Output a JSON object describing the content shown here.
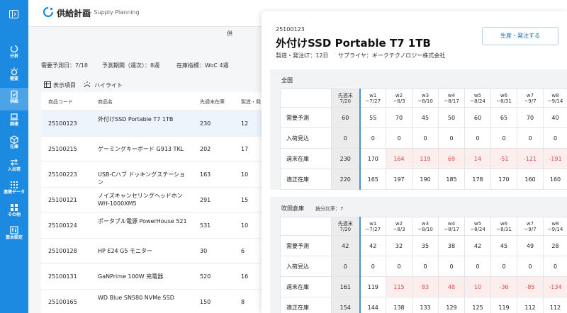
{
  "app": {
    "title": "供給計画",
    "subtitle": "- Supply Planning"
  },
  "sidebar": {
    "items": [
      {
        "label": "分析",
        "icon": "chart-circle-icon"
      },
      {
        "label": "需要",
        "icon": "demand-icon"
      },
      {
        "label": "供給",
        "icon": "clipboard-check-icon"
      },
      {
        "label": "調達",
        "icon": "laptop-icon"
      },
      {
        "label": "在庫",
        "icon": "box-icon"
      },
      {
        "label": "入出荷",
        "icon": "swap-arrows-icon"
      },
      {
        "label": "連携データ",
        "icon": "grid-icon"
      },
      {
        "label": "その他",
        "icon": "apps-icon"
      },
      {
        "label": "基本設定",
        "icon": "sliders-icon"
      }
    ],
    "active_index": 2
  },
  "header": {
    "right_label": "供"
  },
  "filters": {
    "demand_date": "需要予測日：7/18",
    "forecast_period": "予測期間（週次）：8週",
    "stock_index": "在庫指標：WoC 4週"
  },
  "toolbar": {
    "display_items": "表示項目",
    "highlight": "ハイライト"
  },
  "product_list": {
    "columns": [
      "商品コード",
      "商品名",
      "先週末在庫",
      "製造・発"
    ],
    "rows": [
      {
        "code": "25100123",
        "name": "外付けSSD Portable T7 1TB",
        "stock": "230",
        "lt": "12"
      },
      {
        "code": "25100215",
        "name": "ゲーミングキーボード G913 TKL",
        "stock": "202",
        "lt": "17"
      },
      {
        "code": "25100223",
        "name": "USB-Cハブ ドッキングステーション",
        "stock": "163",
        "lt": "10"
      },
      {
        "code": "25100121",
        "name": "ノイズキャンセリングヘッドホン WH-1000XM5",
        "stock": "291",
        "lt": "15"
      },
      {
        "code": "25100124",
        "name": "ポータブル電源 PowerHouse 521",
        "stock": "531",
        "lt": "10"
      },
      {
        "code": "25100128",
        "name": "HP E24 G5 モニター",
        "stock": "30",
        "lt": "6"
      },
      {
        "code": "25100131",
        "name": "GaNPrime 100W 充電器",
        "stock": "520",
        "lt": "16"
      },
      {
        "code": "25100165",
        "name": "WD Blue SN580 NVMe SSD",
        "stock": "150",
        "lt": "8"
      }
    ]
  },
  "detail": {
    "code": "25100123",
    "name": "外付けSSD Portable T7 1TB",
    "lead_time": "製造・発注LT：12日",
    "supplier": "サプライヤ：ギークテクノロジー株式会社",
    "action_button": "生産・発注する",
    "week_headers": [
      [
        "先週末",
        "7/20"
      ],
      [
        "w1",
        "~7/27"
      ],
      [
        "w2",
        "~8/3"
      ],
      [
        "w3",
        "~8/10"
      ],
      [
        "w4",
        "~8/17"
      ],
      [
        "w5",
        "~8/24"
      ],
      [
        "w6",
        "~8/31"
      ],
      [
        "w7",
        "~9/7"
      ],
      [
        "w8",
        "~9/14"
      ]
    ],
    "sections": [
      {
        "title": "全国",
        "ratio": "",
        "rows": [
          {
            "label": "需要予測",
            "values": [
              "60",
              "55",
              "70",
              "45",
              "50",
              "60",
              "65",
              "70",
              "40"
            ]
          },
          {
            "label": "入荷見込",
            "values": [
              "0",
              "0",
              "0",
              "0",
              "0",
              "0",
              "0",
              "0",
              "0"
            ]
          },
          {
            "label": "週末在庫",
            "values": [
              "230",
              "170",
              "164",
              "119",
              "69",
              "14",
              "-51",
              "-121",
              "-191"
            ],
            "highlight_from": 2
          },
          {
            "label": "適正在庫",
            "values": [
              "220",
              "165",
              "197",
              "190",
              "185",
              "178",
              "170",
              "160",
              "160"
            ]
          }
        ]
      },
      {
        "title": "吹田倉庫",
        "ratio": "按分比率：7",
        "rows": [
          {
            "label": "需要予測",
            "values": [
              "42",
              "42",
              "32",
              "35",
              "38",
              "42",
              "45",
              "49",
              "28"
            ]
          },
          {
            "label": "入荷見込",
            "values": [
              "0",
              "0",
              "0",
              "0",
              "0",
              "0",
              "0",
              "0",
              "0"
            ]
          },
          {
            "label": "週末在庫",
            "values": [
              "161",
              "119",
              "115",
              "83",
              "48",
              "10",
              "-36",
              "-85",
              "-134"
            ],
            "highlight_from": 2
          },
          {
            "label": "適正在庫",
            "values": [
              "154",
              "144",
              "138",
              "133",
              "129",
              "125",
              "119",
              "112",
              "112"
            ]
          }
        ]
      }
    ]
  },
  "colors": {
    "accent": "#1b8ae0",
    "negative": "#e0474c",
    "negative_bg": "#fdeeee"
  }
}
